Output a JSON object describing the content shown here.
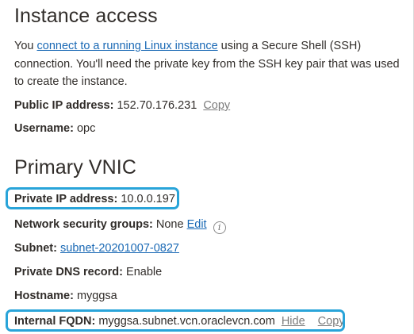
{
  "instance_access": {
    "title": "Instance access",
    "intro_before": "You ",
    "intro_link": "connect to a running Linux instance",
    "intro_after": " using a Secure Shell (SSH) connection. You'll need the private key from the SSH key pair that was used to create the instance.",
    "public_ip": {
      "label": "Public IP address:",
      "value": "152.70.176.231",
      "copy_label": "Copy"
    },
    "username": {
      "label": "Username:",
      "value": "opc"
    }
  },
  "primary_vnic": {
    "title": "Primary VNIC",
    "private_ip": {
      "label": "Private IP address:",
      "value": "10.0.0.197"
    },
    "nsg": {
      "label": "Network security groups:",
      "value": "None",
      "edit_label": "Edit",
      "info_icon_glyph": "i"
    },
    "subnet": {
      "label": "Subnet:",
      "value": "subnet-20201007-0827"
    },
    "dns": {
      "label": "Private DNS record:",
      "value": "Enable"
    },
    "hostname": {
      "label": "Hostname:",
      "value": "myggsa"
    },
    "fqdn": {
      "label": "Internal FQDN:",
      "value": "myggsa.subnet.vcn.oraclevcn.com",
      "hide_label": "Hide",
      "copy_label": "Copy"
    }
  },
  "colors": {
    "link": "#1a69b5",
    "action_link": "#7b7b7b",
    "highlight": "#29a4d9",
    "text": "#312d2a"
  }
}
